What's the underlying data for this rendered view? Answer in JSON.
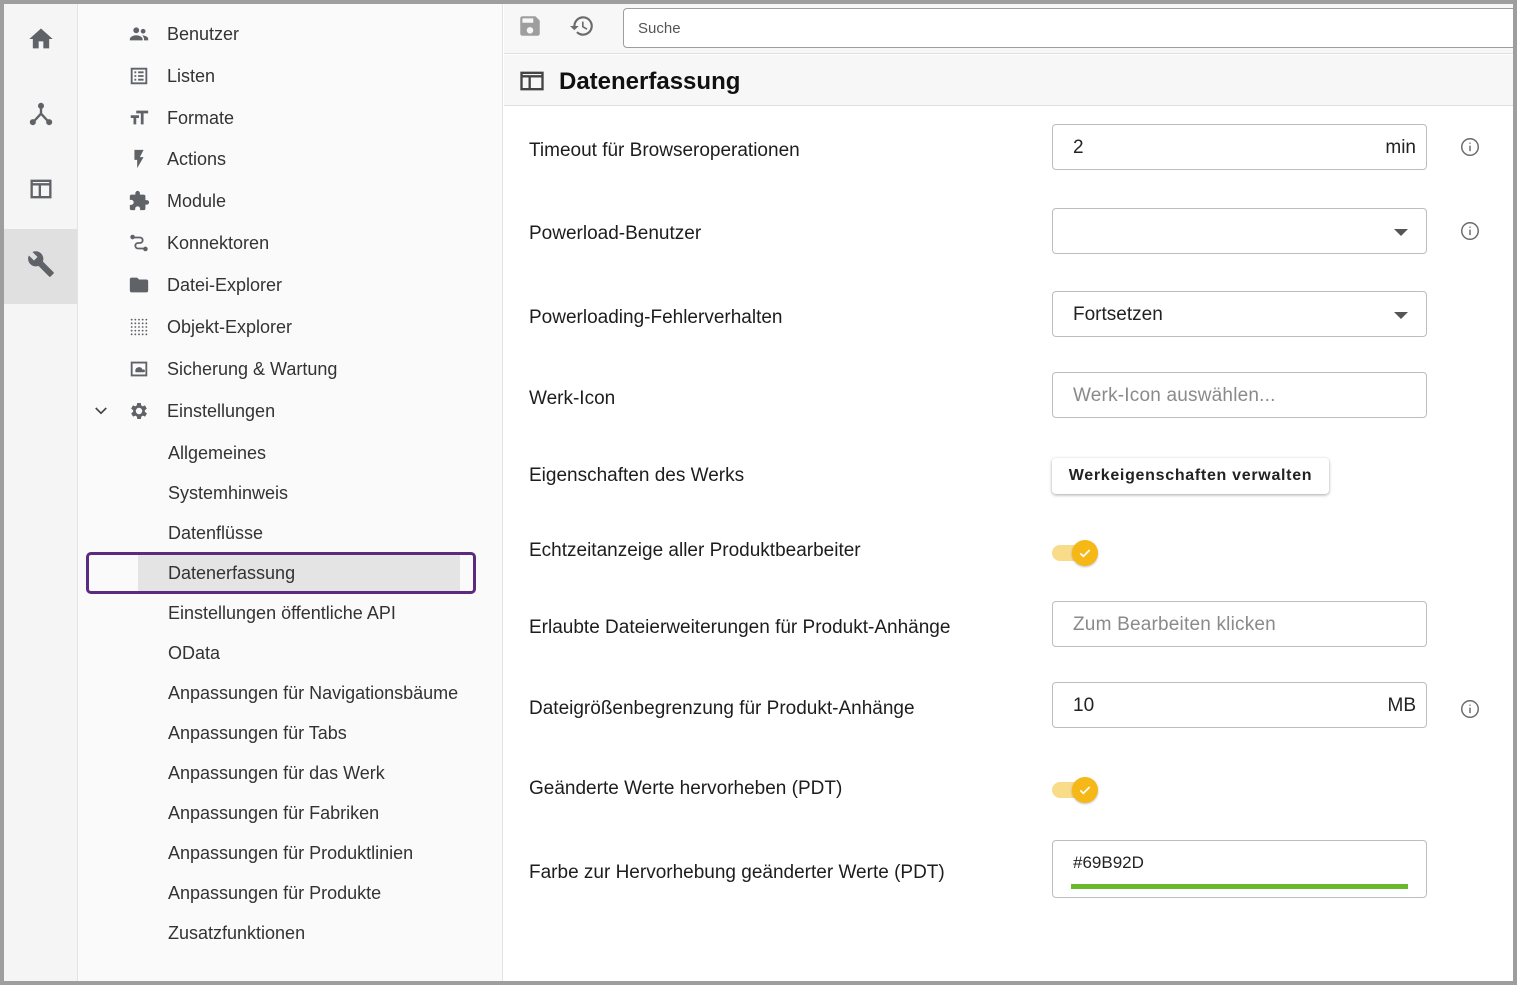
{
  "rail": {
    "items": [
      {
        "name": "home",
        "icon": "home-icon"
      },
      {
        "name": "hierarchy",
        "icon": "hierarchy-icon"
      },
      {
        "name": "layout",
        "icon": "layout-icon"
      },
      {
        "name": "tools",
        "icon": "wrench-icon",
        "active": true
      }
    ]
  },
  "nav": {
    "items": [
      {
        "label": "Benutzer",
        "icon": "users-icon"
      },
      {
        "label": "Listen",
        "icon": "list-icon"
      },
      {
        "label": "Formate",
        "icon": "text-format-icon"
      },
      {
        "label": "Actions",
        "icon": "flash-icon"
      },
      {
        "label": "Module",
        "icon": "puzzle-icon"
      },
      {
        "label": "Konnektoren",
        "icon": "connector-icon"
      },
      {
        "label": "Datei-Explorer",
        "icon": "folder-icon"
      },
      {
        "label": "Objekt-Explorer",
        "icon": "dots-grid-icon"
      },
      {
        "label": "Sicherung & Wartung",
        "icon": "backup-icon"
      },
      {
        "label": "Einstellungen",
        "icon": "gear-icon",
        "expanded": true
      }
    ],
    "settings_sub": [
      "Allgemeines",
      "Systemhinweis",
      "Datenflüsse",
      "Datenerfassung",
      "Einstellungen öffentliche API",
      "OData",
      "Anpassungen für Navigationsbäume",
      "Anpassungen für Tabs",
      "Anpassungen für das Werk",
      "Anpassungen für Fabriken",
      "Anpassungen für Produktlinien",
      "Anpassungen für Produkte",
      "Zusatzfunktionen"
    ],
    "selected": "Datenerfassung"
  },
  "toolbar": {
    "search_placeholder": "Suche"
  },
  "page": {
    "title": "Datenerfassung"
  },
  "form": {
    "timeout": {
      "label": "Timeout für Browseroperationen",
      "value": "2",
      "unit": "min"
    },
    "powerload_user": {
      "label": "Powerload-Benutzer",
      "value": ""
    },
    "powerload_error": {
      "label": "Powerloading-Fehlerverhalten",
      "value": "Fortsetzen"
    },
    "werk_icon": {
      "label": "Werk-Icon",
      "placeholder": "Werk-Icon auswählen..."
    },
    "werk_props": {
      "label": "Eigenschaften des Werks",
      "button": "Werkeigenschaften verwalten"
    },
    "realtime": {
      "label": "Echtzeitanzeige aller Produktbearbeiter",
      "enabled": true
    },
    "extensions": {
      "label": "Erlaubte Dateierweiterungen für Produkt-Anhänge",
      "placeholder": "Zum Bearbeiten klicken"
    },
    "filesize": {
      "label": "Dateigrößenbegrenzung für Produkt-Anhänge",
      "value": "10",
      "unit": "MB"
    },
    "highlight": {
      "label": "Geänderte Werte hervorheben (PDT)",
      "enabled": true
    },
    "highlight_color": {
      "label": "Farbe zur Hervorhebung geänderter Werte (PDT)",
      "value": "#69B92D"
    }
  },
  "colors": {
    "accent_toggle": "#f6b817",
    "selection_outline": "#5c2a7e",
    "highlight_color": "#69B92D"
  }
}
